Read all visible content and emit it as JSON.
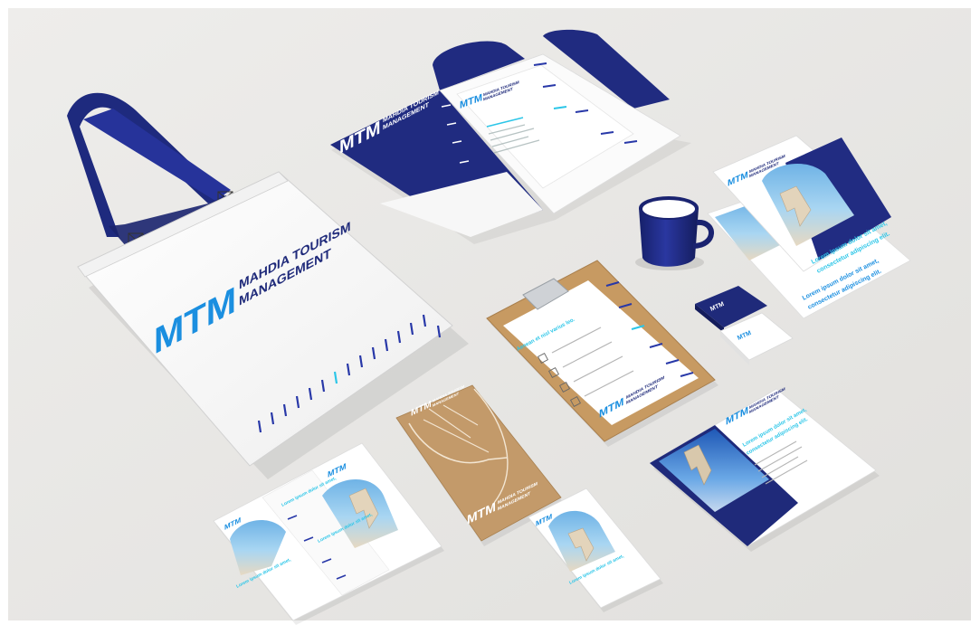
{
  "brand": {
    "initials": "MTM",
    "name_line1": "MAHDIA TOURISM",
    "name_line2": "MANAGEMENT",
    "short_line1": "MAHDIA TOURISM",
    "short_line2": "MANAGEMENT"
  },
  "copy": {
    "headline": "Lorem ipsum dolor sit amet,",
    "headline2": "consectetur adipiscing elit.",
    "clipboard_heading": "Aenean et nisl varius leo."
  },
  "colors": {
    "background": "#e9e8e6",
    "navy": "#1f2a7a",
    "brand_blue": "#1b8fe0",
    "cyan": "#2cc6e8",
    "kraft": "#c39a6a",
    "paper": "#f8f8f7"
  },
  "items": [
    "tote-bag",
    "presentation-folder",
    "mug",
    "flyer-stack",
    "clipboard",
    "business-cards",
    "kraft-envelope",
    "tri-fold-brochure",
    "dl-flyer",
    "landscape-brochure"
  ]
}
